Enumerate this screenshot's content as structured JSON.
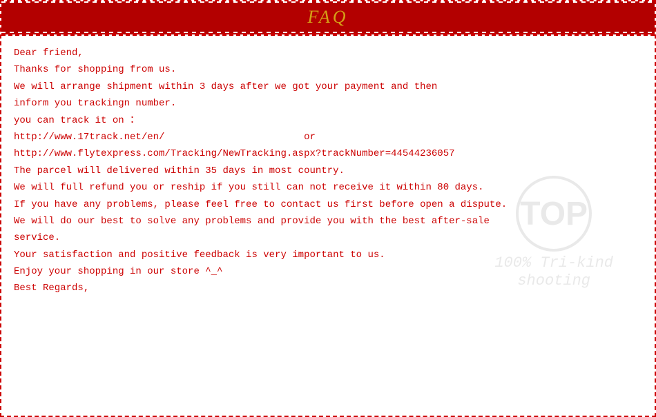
{
  "header": {
    "title": "FAQ",
    "bg_color": "#b30000",
    "title_color": "#d4a017"
  },
  "content": {
    "lines": [
      "Dear friend,",
      "Thanks for shopping from us.",
      "We will arrange shipment within 3 days after we got your payment and then",
      "inform you trackingn number.",
      "you can track it on ：",
      "http://www.17track.net/en/                        or",
      "http://www.flytexpress.com/Tracking/NewTracking.aspx?trackNumber=44544236057",
      "The parcel will delivered within 35 days in most country.",
      "We will full refund you or reship if you still can not receive it within 80 days.",
      "If you have any problems, please feel free to contact us first before open a dispute.",
      "We will do our best to solve any problems and provide you with the best after-sale",
      "service.",
      "Your satisfaction and positive feedback is very important to us.",
      "Enjoy your shopping in our store ^_^",
      "Best Regards,"
    ]
  },
  "watermark": {
    "circle_text": "TOP",
    "line1": "100% Tri-kind",
    "line2": "shooting"
  }
}
